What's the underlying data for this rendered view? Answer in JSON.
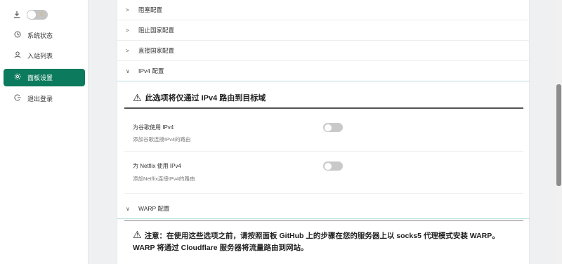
{
  "sidebar": {
    "theme_toggle_on": false,
    "items": [
      {
        "label": "系统状态",
        "icon": "dashboard-icon",
        "active": false
      },
      {
        "label": "入站列表",
        "icon": "user-icon",
        "active": false
      },
      {
        "label": "面板设置",
        "icon": "gear-icon",
        "active": true
      },
      {
        "label": "退出登录",
        "icon": "logout-icon",
        "active": false
      }
    ]
  },
  "sections": {
    "block": "阻塞配置",
    "block_country": "阻止国家配置",
    "direct_country": "直接国家配置",
    "ipv4": "IPv4 配置",
    "warp": "WARP 配置"
  },
  "ipv4_panel": {
    "warning": "此选项将仅通过 IPv4 路由到目标域",
    "settings": [
      {
        "label": "为谷歌使用 IPv4",
        "desc": "添加谷歌连接IPv4的路由",
        "enabled": false
      },
      {
        "label": "为 Netflix 使用 IPv4",
        "desc": "添加Netflix连接IPv4的路由",
        "enabled": false
      }
    ]
  },
  "warp_panel": {
    "warning": "注意：在使用这些选项之前，请按照面板 GitHub 上的步骤在您的服务器上以 socks5 代理模式安装 WARP。 WARP 将通过 Cloudflare 服务器将流量路由到网站。"
  },
  "colors": {
    "accent": "#0c7a5c",
    "open_border": "#b8dfdd"
  }
}
